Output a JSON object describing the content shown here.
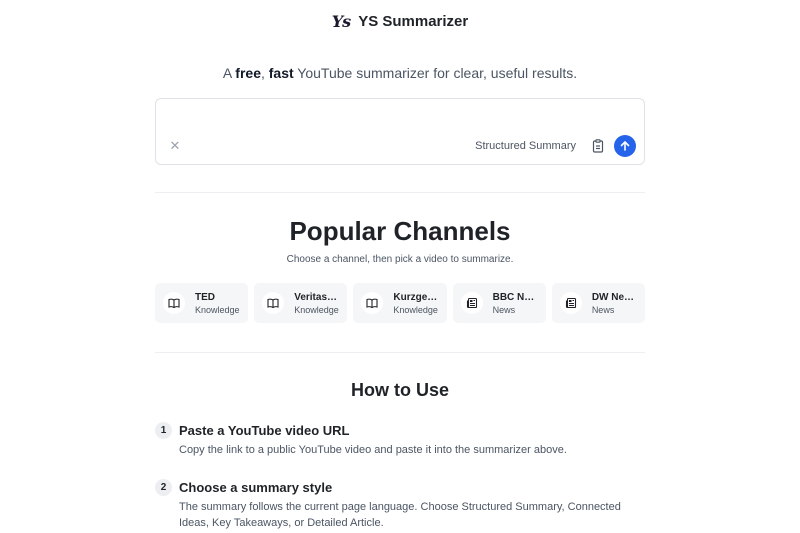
{
  "header": {
    "logo_text": "Ys",
    "brand": "YS Summarizer"
  },
  "tagline": {
    "prefix": "A ",
    "free": "free",
    "comma": ", ",
    "fast": "fast",
    "suffix": " YouTube summarizer for clear, useful results."
  },
  "input": {
    "value": "",
    "placeholder": "",
    "mode_label": "Structured Summary",
    "clear_icon": "close-icon",
    "paste_icon": "clipboard-icon",
    "submit_icon": "arrow-up-icon",
    "submit_color": "#2563eb"
  },
  "popular": {
    "title": "Popular Channels",
    "subtitle": "Choose a channel, then pick a video to summarize.",
    "channels": [
      {
        "name": "TED",
        "category": "Knowledge",
        "icon": "book-icon"
      },
      {
        "name": "Veritasi…",
        "category": "Knowledge",
        "icon": "book-icon"
      },
      {
        "name": "Kurzge…",
        "category": "Knowledge",
        "icon": "book-icon"
      },
      {
        "name": "BBC Ne…",
        "category": "News",
        "icon": "newspaper-icon"
      },
      {
        "name": "DW News",
        "category": "News",
        "icon": "newspaper-icon"
      }
    ]
  },
  "how_to": {
    "title": "How to Use",
    "steps": [
      {
        "num": "1",
        "title": "Paste a YouTube video URL",
        "desc": "Copy the link to a public YouTube video and paste it into the summarizer above."
      },
      {
        "num": "2",
        "title": "Choose a summary style",
        "desc": "The summary follows the current page language. Choose Structured Summary, Connected Ideas, Key Takeaways, or Detailed Article."
      }
    ]
  }
}
